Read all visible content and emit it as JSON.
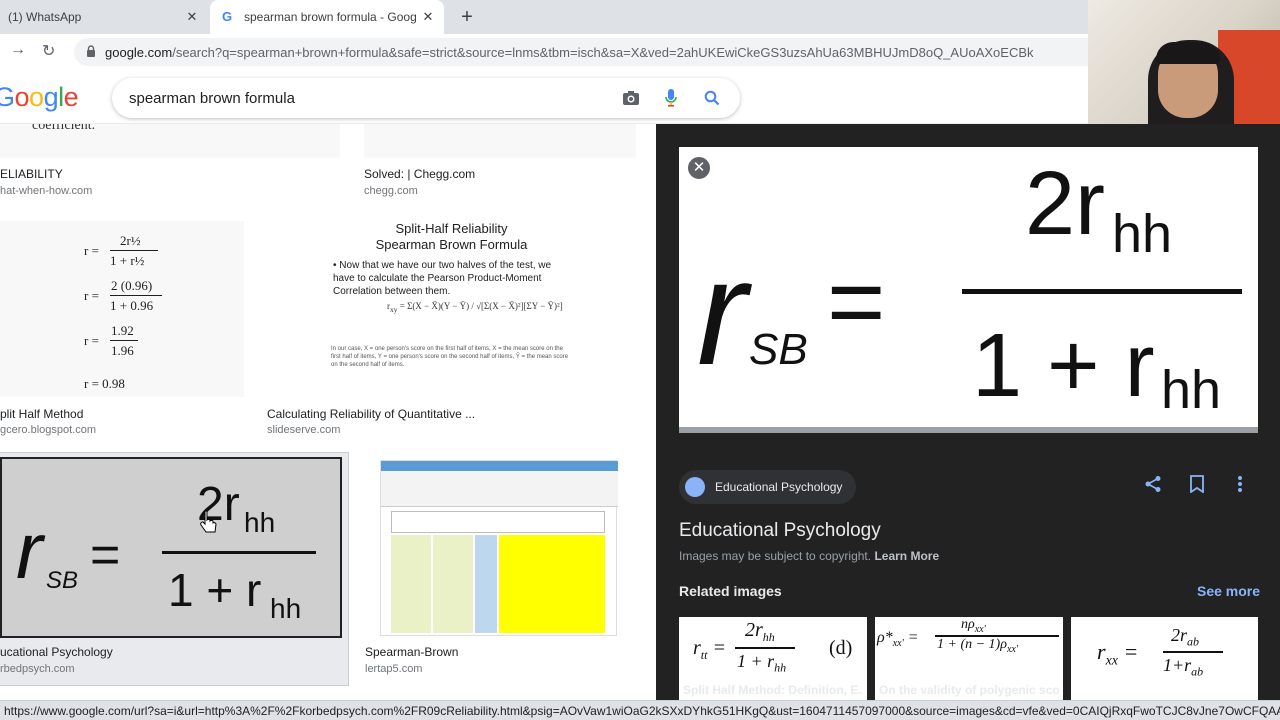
{
  "browser": {
    "tabs": [
      {
        "title": "(1) WhatsApp",
        "active": false
      },
      {
        "title": "spearman brown formula - Goog",
        "active": true
      }
    ],
    "url_domain": "google.com",
    "url_path": "/search?q=spearman+brown+formula&safe=strict&source=lnms&tbm=isch&sa=X&ved=2ahUKEwiCkeGS3uzsAhUa63MBHUJmD8oQ_AUoAXoECBk",
    "status_url": "https://www.google.com/url?sa=i&url=http%3A%2F%2Fkorbedpsych.com%2FR09cReliability.html&psig=AOvVaw1wiOaG2kSXxDYhkG51HKgQ&ust=1604711457097000&source=images&cd=vfe&ved=0CAIQjRxqFwoTCJC8vJne7OwCFQAAAAAdAAA..."
  },
  "search": {
    "query": "spearman brown formula",
    "logo_text": [
      "G",
      "o",
      "o",
      "g",
      "l",
      "e"
    ]
  },
  "results": [
    {
      "caption": "ELIABILITY",
      "source": "hat-when-how.com",
      "thumb_text": "coefficient."
    },
    {
      "caption": "Solved: | Chegg.com",
      "source": "chegg.com"
    },
    {
      "caption": "plit Half Method",
      "source": "gcero.blogspot.com",
      "lines": [
        {
          "lhs": "r =",
          "num": "2r½",
          "den": "1 + r½"
        },
        {
          "lhs": "r =",
          "num": "2 (0.96)",
          "den": "1 + 0.96"
        },
        {
          "lhs": "r =",
          "num": "1.92",
          "den": "1.96"
        },
        {
          "lhs": "r = 0.98"
        }
      ]
    },
    {
      "caption": "Calculating Reliability of Quantitative ...",
      "source": "slideserve.com",
      "slide_title_1": "Split-Half Reliability",
      "slide_title_2": "Spearman Brown Formula",
      "slide_bullet": "Now that we have our two halves of the test, we have to calculate the Pearson Product-Moment Correlation between them.",
      "slide_note": "In our case, X = one person's score on the first half of items, X̄ = the mean score on the first half of items, Y = one person's score on the second half of items, Ȳ = the mean score on the second half of items."
    },
    {
      "caption": "ucational Psychology",
      "source": "rbedpsych.com"
    },
    {
      "caption": "Spearman-Brown",
      "source": "lertap5.com"
    }
  ],
  "formula": {
    "r": "r",
    "sub_sb": "SB",
    "eq": "=",
    "num": "2r",
    "sub_hh": "hh",
    "den": "1 + r"
  },
  "panel": {
    "site_chip": "Educational Psychology",
    "title": "Educational Psychology",
    "copyright": "Images may be subject to copyright.",
    "learn_more": "Learn More",
    "related_heading": "Related images",
    "see_more": "See more",
    "related": [
      {
        "caption": "Split Half Method: Definition, E..."
      },
      {
        "caption": "On the validity of polygenic sco..."
      },
      {
        "caption": ""
      }
    ]
  },
  "colors": {
    "google_blue": "#4285f4",
    "google_red": "#ea4335",
    "google_yellow": "#fbbc05",
    "google_green": "#34a853",
    "panel_bg": "#222222",
    "link_blue": "#8ab4f8"
  }
}
